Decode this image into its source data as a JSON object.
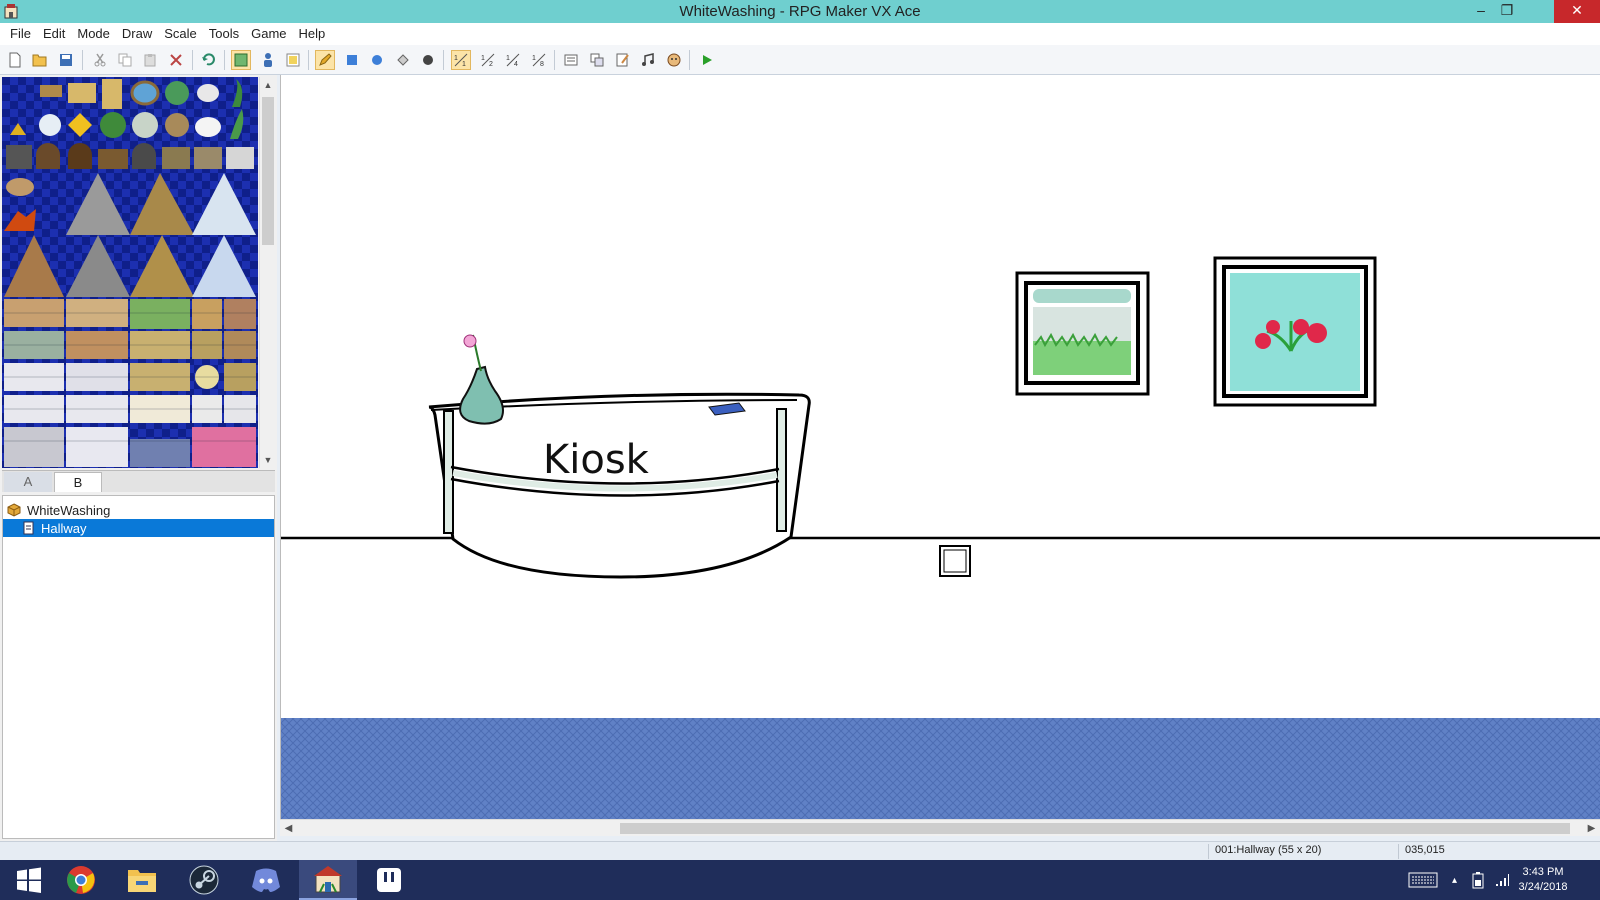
{
  "window": {
    "title": "WhiteWashing - RPG Maker VX Ace",
    "minimize_glyph": "–",
    "restore_glyph": "❐",
    "close_glyph": "✕"
  },
  "menu": [
    "File",
    "Edit",
    "Mode",
    "Draw",
    "Scale",
    "Tools",
    "Game",
    "Help"
  ],
  "toolbar": {
    "icons": [
      "new-project-icon",
      "open-project-icon",
      "save-project-icon",
      "cut-icon",
      "copy-icon",
      "paste-icon",
      "delete-icon",
      "undo-icon",
      "map-mode-icon",
      "event-mode-icon",
      "region-mode-icon",
      "pencil-icon",
      "rectangle-icon",
      "ellipse-icon",
      "flood-fill-icon",
      "shadow-pen-icon",
      "scale-1-1-icon",
      "scale-1-2-icon",
      "scale-1-4-icon",
      "scale-1-8-icon",
      "database-icon",
      "resource-manager-icon",
      "script-editor-icon",
      "sound-test-icon",
      "character-generator-icon",
      "playtest-icon"
    ],
    "active": [
      "map-mode-icon",
      "pencil-icon",
      "scale-1-1-icon"
    ]
  },
  "tileset": {
    "tabs": [
      "A",
      "B"
    ],
    "active_tab": "B"
  },
  "map_tree": {
    "project": "WhiteWashing",
    "maps": [
      {
        "name": "Hallway",
        "selected": true
      }
    ]
  },
  "map": {
    "kiosk_label": "Kiosk",
    "colors": {
      "wall": "#ffffff",
      "floor_pattern": "#5f7ec4",
      "frame": "#000000",
      "vase": "#7fbfb0",
      "painting_bg": "#8fe0d8",
      "flower": "#e0284a"
    }
  },
  "status": {
    "map_info": "001:Hallway (55 x 20)",
    "coords": "035,015"
  },
  "taskbar": {
    "apps": [
      "windows-start-icon",
      "chrome-icon",
      "file-explorer-icon",
      "steam-icon",
      "discord-icon",
      "rpg-maker-icon",
      "stop-sign-app-icon"
    ],
    "active_app": "rpg-maker-icon",
    "tray_up_glyph": "▴",
    "time": "3:43 PM",
    "date": "3/24/2018"
  }
}
